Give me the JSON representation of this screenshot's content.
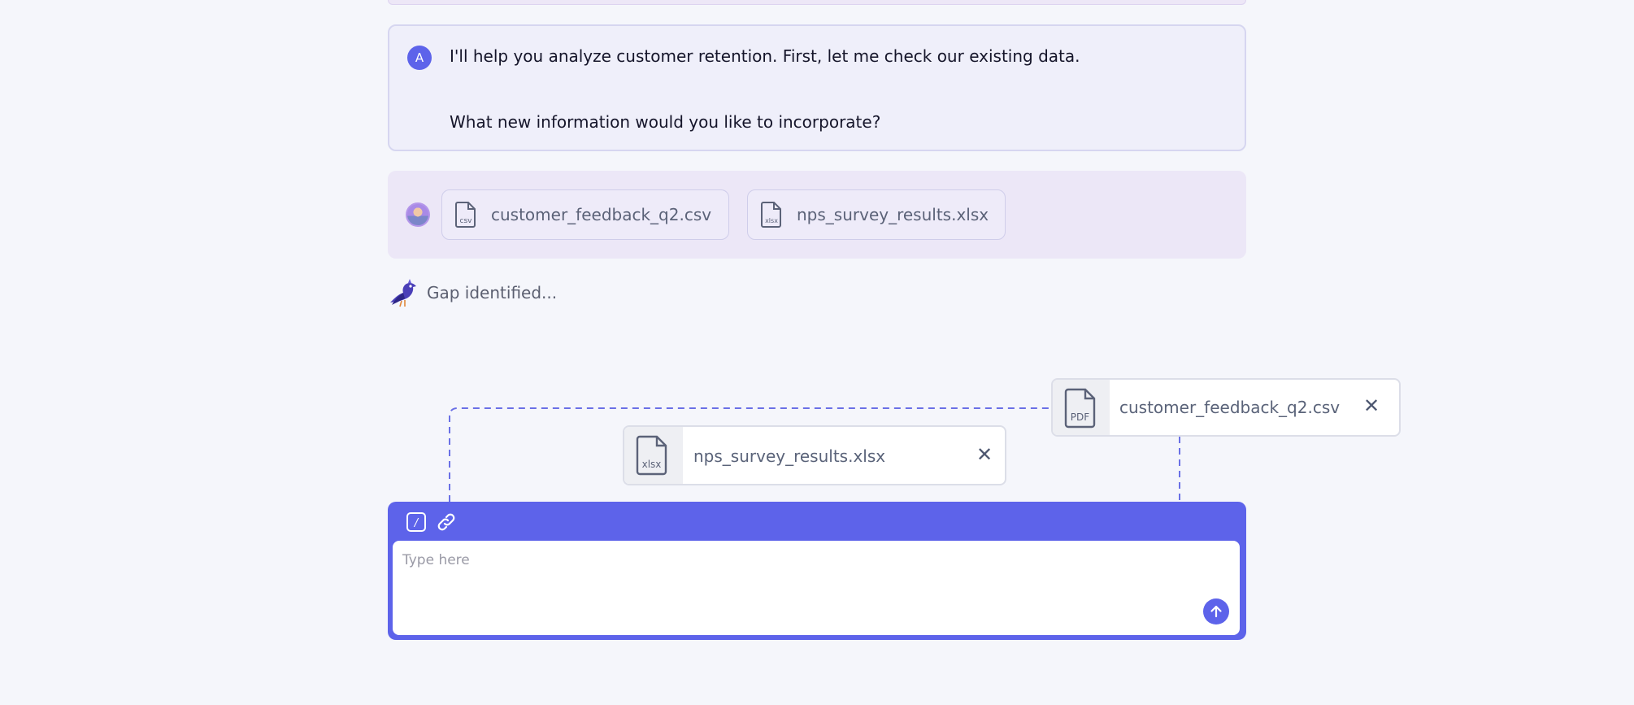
{
  "assistant": {
    "avatar_letter": "A",
    "line1": "I'll help you analyze customer retention. First, let me check our existing data.",
    "line2": "What new information would you like to incorporate?"
  },
  "user_files": [
    {
      "name": "customer_feedback_q2.csv",
      "icon_label": "csv"
    },
    {
      "name": "nps_survey_results.xlsx",
      "icon_label": "xlsx"
    }
  ],
  "status": {
    "text": "Gap identified..."
  },
  "floating_files": {
    "pdf": {
      "name": "customer_feedback_q2.csv",
      "icon_label": "PDF",
      "close": "✕"
    },
    "xlsx": {
      "name": "nps_survey_results.xlsx",
      "icon_label": "xlsx",
      "close": "✕"
    }
  },
  "composer": {
    "placeholder": "Type here",
    "slash_label": "/"
  },
  "colors": {
    "accent": "#5d63ea",
    "background": "#f5f6fb",
    "assistant_bg": "#efeffa",
    "user_bg": "#ece7f7"
  }
}
